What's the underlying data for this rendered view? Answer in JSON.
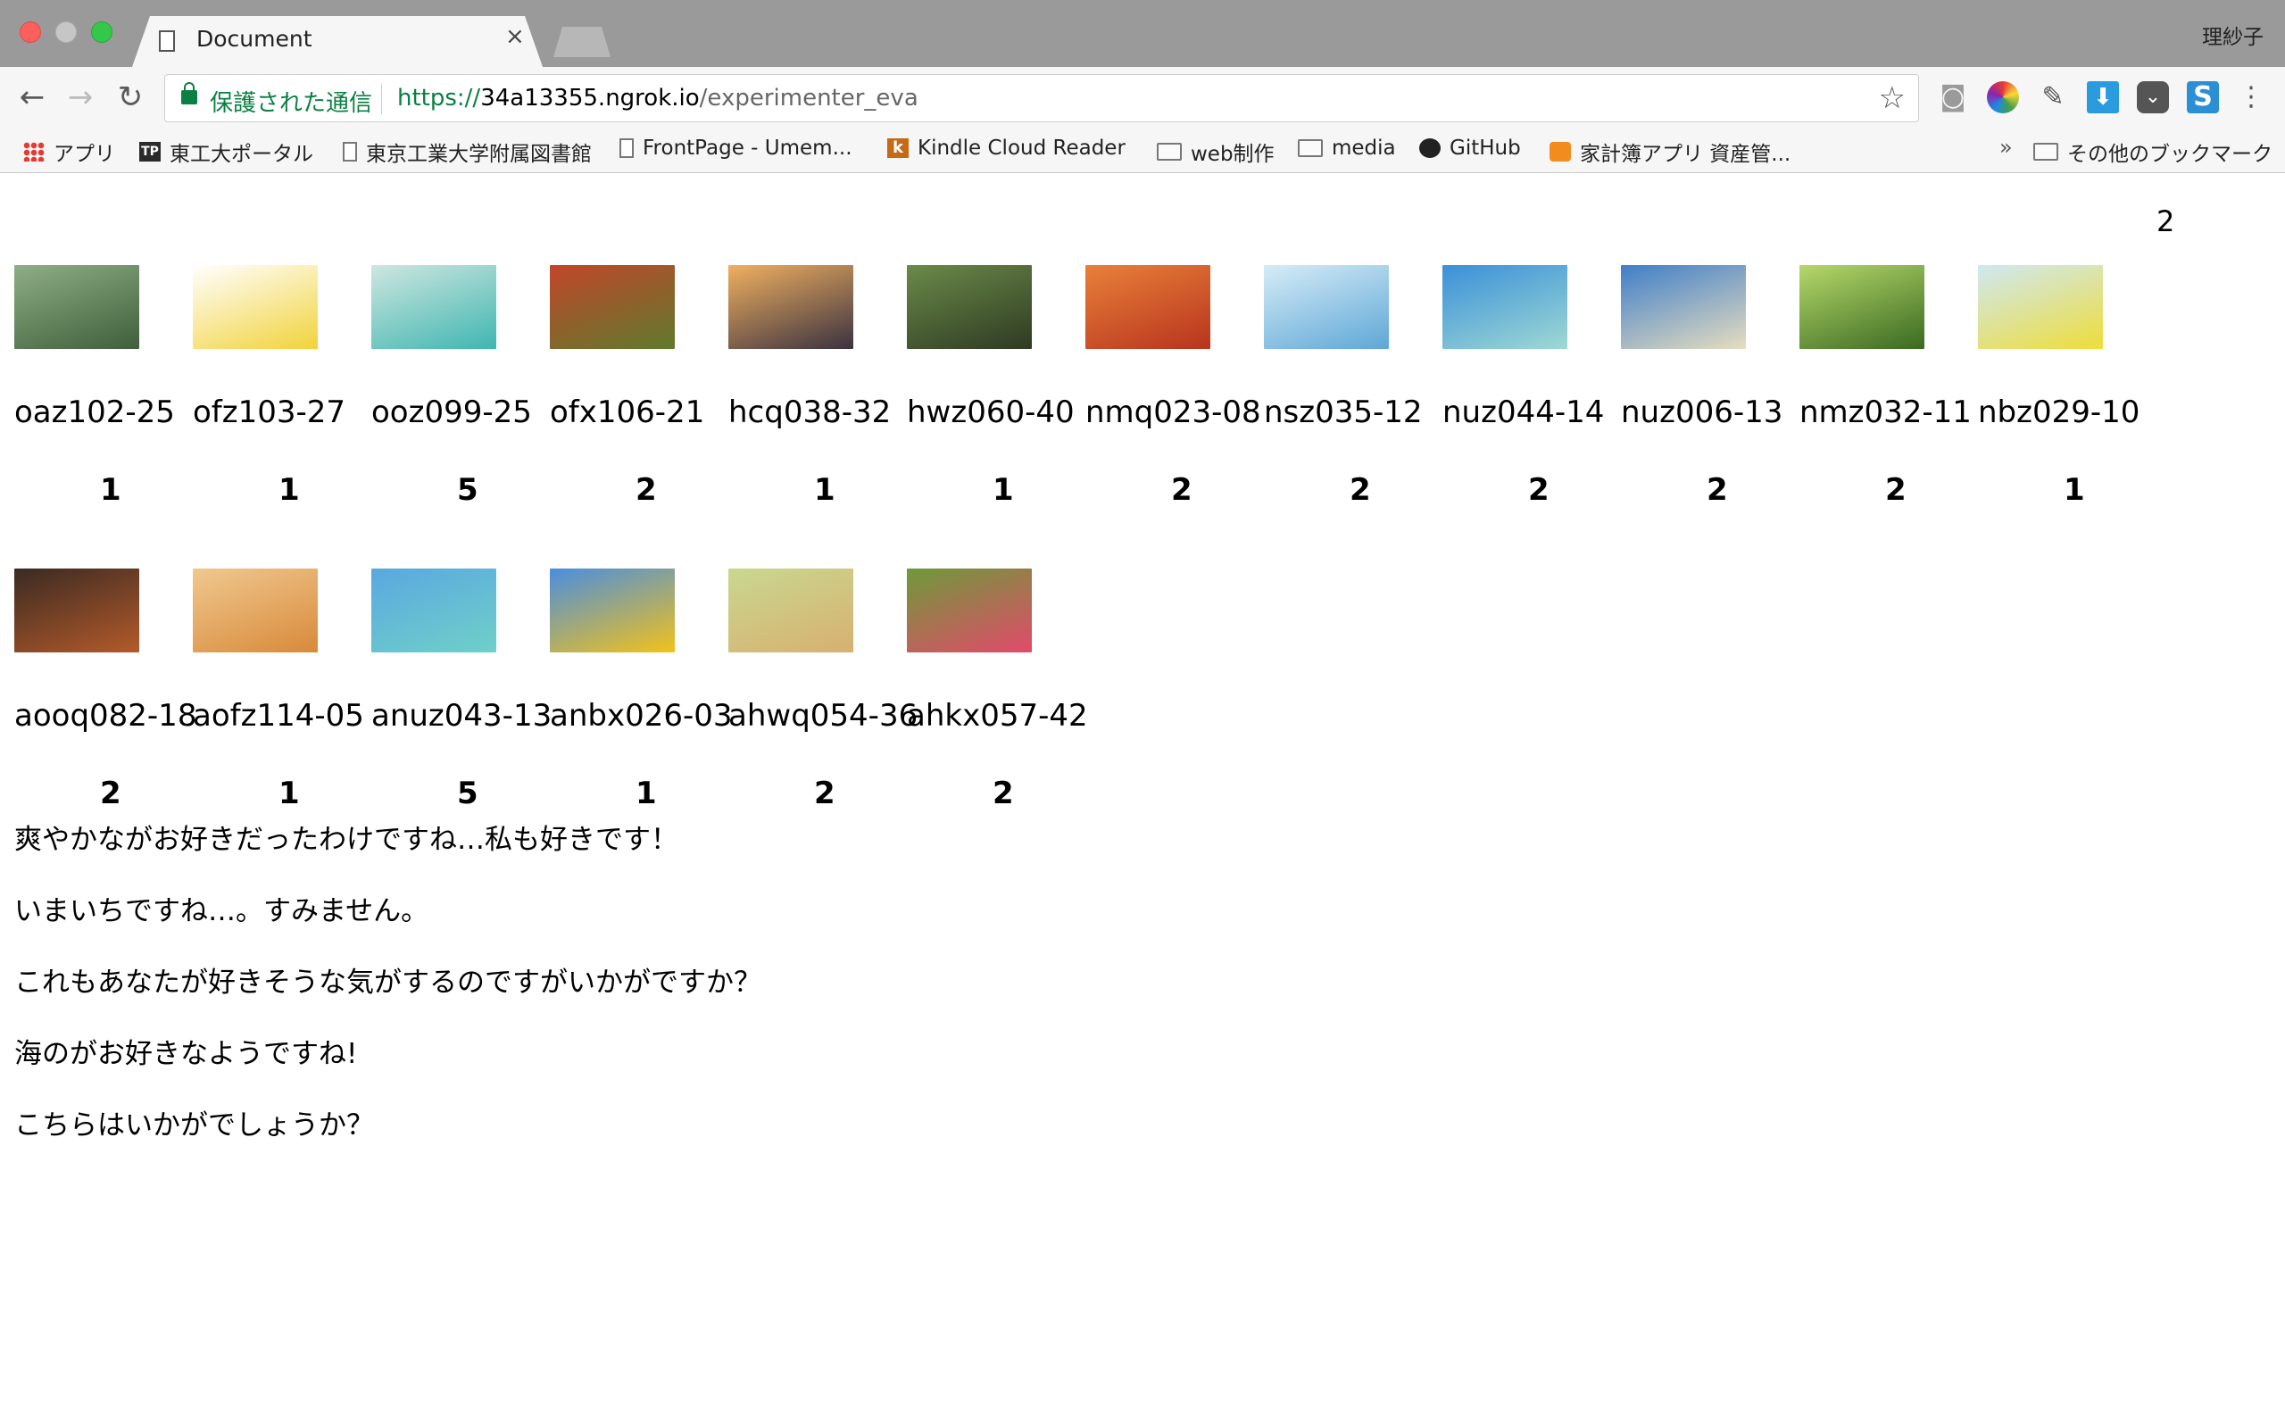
{
  "window": {
    "tab_title": "Document",
    "close_glyph": "×",
    "profile_name": "理紗子"
  },
  "toolbar": {
    "back_glyph": "←",
    "forward_glyph": "→",
    "reload_glyph": "↻",
    "secure_label": "保護された通信",
    "url_scheme": "https://",
    "url_host": "34a13355.ngrok.io",
    "url_path": "/experimenter_eva",
    "star_glyph": "☆",
    "menu_glyph": "⋮",
    "extensions": [
      "camera-icon",
      "color-picker-icon",
      "eyedropper-icon",
      "download-icon",
      "pocket-icon",
      "s-extension-icon"
    ]
  },
  "bookmarks": {
    "items": [
      {
        "label": "アプリ",
        "icon": "apps-icon"
      },
      {
        "label": "東工大ポータル",
        "icon": "titech-portal-icon"
      },
      {
        "label": "東京工業大学附属図書館",
        "icon": "page-icon"
      },
      {
        "label": "FrontPage - Umem...",
        "icon": "page-icon"
      },
      {
        "label": "Kindle Cloud Reader",
        "icon": "kindle-icon"
      },
      {
        "label": "web制作",
        "icon": "folder-icon"
      },
      {
        "label": "media",
        "icon": "folder-icon"
      },
      {
        "label": "GitHub",
        "icon": "github-icon"
      },
      {
        "label": "家計簿アプリ 資産管...",
        "icon": "kakeibo-icon"
      }
    ],
    "overflow_glyph": "»",
    "other_label": "その他のブックマーク"
  },
  "page": {
    "top_number": "2",
    "items": [
      {
        "id": "oaz102-25",
        "rating": "1",
        "image": "bubbles-photo",
        "colors": [
          "#8fae86",
          "#3e5f3a"
        ]
      },
      {
        "id": "ofz103-27",
        "rating": "1",
        "image": "lemons-photo",
        "colors": [
          "#ffffff",
          "#f1d33a"
        ]
      },
      {
        "id": "ooz099-25",
        "rating": "5",
        "image": "glass-wind-chimes-photo",
        "colors": [
          "#cfe6e0",
          "#3fb6b0"
        ]
      },
      {
        "id": "ofx106-21",
        "rating": "2",
        "image": "vegetables-photo",
        "colors": [
          "#c2462a",
          "#5e7a2c"
        ]
      },
      {
        "id": "hcq038-32",
        "rating": "1",
        "image": "sunset-couple-photo",
        "colors": [
          "#f0b060",
          "#3b3240"
        ]
      },
      {
        "id": "hwz060-40",
        "rating": "1",
        "image": "girl-garden-photo",
        "colors": [
          "#6b8a4a",
          "#2e3a22"
        ]
      },
      {
        "id": "nmq023-08",
        "rating": "2",
        "image": "autumn-trees-photo",
        "colors": [
          "#e8803a",
          "#b8341e"
        ]
      },
      {
        "id": "nsz035-12",
        "rating": "2",
        "image": "sky-sun-photo",
        "colors": [
          "#d6ecf7",
          "#5ea7d6"
        ]
      },
      {
        "id": "nuz044-14",
        "rating": "2",
        "image": "ocean-shore-photo",
        "colors": [
          "#3a8fd8",
          "#9fd9d4"
        ]
      },
      {
        "id": "nuz006-13",
        "rating": "2",
        "image": "beach-photo",
        "colors": [
          "#3f7ec8",
          "#e6ddc0"
        ]
      },
      {
        "id": "nmz032-11",
        "rating": "2",
        "image": "green-forest-photo",
        "colors": [
          "#b6d86a",
          "#3a6a22"
        ]
      },
      {
        "id": "nbz029-10",
        "rating": "1",
        "image": "rapeseed-field-photo",
        "colors": [
          "#cfe8f2",
          "#eedd3a"
        ]
      },
      {
        "id": "aooq082-18",
        "rating": "2",
        "image": "camera-photo",
        "colors": [
          "#3a2a22",
          "#b45a2a"
        ]
      },
      {
        "id": "aofz114-05",
        "rating": "1",
        "image": "fruit-tart-photo",
        "colors": [
          "#f0c890",
          "#d88a3a"
        ]
      },
      {
        "id": "anuz043-13",
        "rating": "5",
        "image": "tropical-beach-photo",
        "colors": [
          "#5aa8e0",
          "#6fd0c8"
        ]
      },
      {
        "id": "anbx026-03",
        "rating": "1",
        "image": "sunflower-photo",
        "colors": [
          "#4a8ee0",
          "#f2c21a"
        ]
      },
      {
        "id": "ahwq054-36",
        "rating": "2",
        "image": "woman-hat-photo",
        "colors": [
          "#c8d890",
          "#d8b070"
        ]
      },
      {
        "id": "ahkx057-42",
        "rating": "2",
        "image": "smiling-girl-photo",
        "colors": [
          "#6e9a3a",
          "#e24a6a"
        ]
      }
    ],
    "messages": [
      "爽やかながお好きだったわけですね…私も好きです！",
      "いまいちですね…。すみません。",
      "これもあなたが好きそうな気がするのですがいかがですか？",
      "海のがお好きなようですね!",
      "こちらはいかがでしょうか？"
    ]
  }
}
